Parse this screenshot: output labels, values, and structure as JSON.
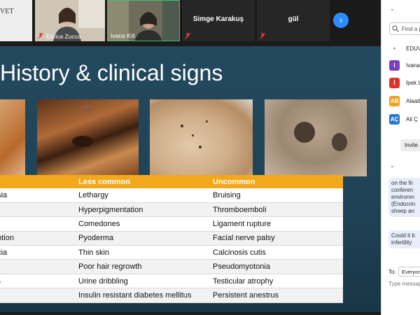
{
  "participants": [
    {
      "name": "",
      "logo_lines": [
        "",
        "VET"
      ]
    },
    {
      "name": "Enrica Zucca"
    },
    {
      "name": "Ivana Kiš"
    },
    {
      "name": "Simge Karakuş"
    },
    {
      "name": "gül"
    }
  ],
  "slide": {
    "title": "History & clinical signs",
    "table": {
      "headers": [
        "",
        "Less common",
        "Uncommon"
      ],
      "rows": [
        [
          "psia",
          "Lethargy",
          "Bruising"
        ],
        [
          "",
          "Hyperpigmentation",
          "Thromboemboli"
        ],
        [
          "",
          "Comedones",
          "Ligament rupture"
        ],
        [
          "ention",
          "Pyoderma",
          "Facial nerve palsy"
        ],
        [
          "ecia",
          "Thin skin",
          "Calcinosis cutis"
        ],
        [
          "",
          "Poor hair regrowth",
          "Pseudomyotonia"
        ],
        [
          "ss",
          "Urine dribbling",
          "Testicular atrophy"
        ],
        [
          "",
          "Insulin resistant diabetes mellitus",
          "Persistent anestrus"
        ]
      ]
    }
  },
  "panel": {
    "find_placeholder": "Find a p",
    "people": [
      {
        "initials": "",
        "name": "EDUV",
        "color": "#ffffff"
      },
      {
        "initials": "I",
        "name": "Ivana",
        "color": "#7c3fbf"
      },
      {
        "initials": "İ",
        "name": "İpek U",
        "color": "#e0322b"
      },
      {
        "initials": "AB",
        "name": "Alaatt",
        "color": "#f0a020"
      },
      {
        "initials": "AÇ",
        "name": "Ali Ç",
        "color": "#2779c9"
      }
    ],
    "invite_label": "Invite",
    "chat_bubble_1": [
      "on the fir",
      "conferen",
      "environm",
      "(Endocrin",
      "sheep an"
    ],
    "chat_bubble_2": [
      "Could it b",
      "infertility"
    ],
    "to_label": "To:",
    "to_value": "Everyon",
    "message_placeholder": "Type messag"
  }
}
